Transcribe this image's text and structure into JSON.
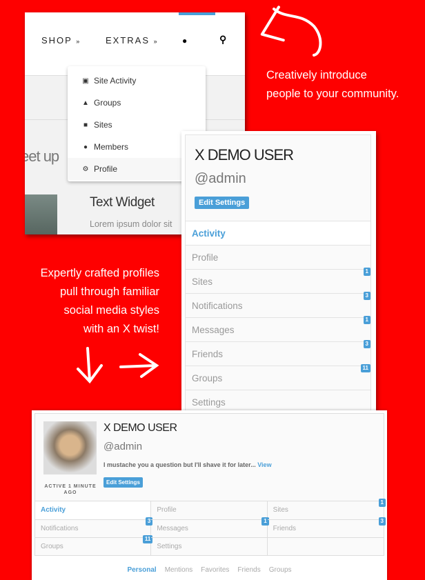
{
  "nav": {
    "shop": "SHOP",
    "extras": "EXTRAS",
    "chevron": "»"
  },
  "page": {
    "heading": "eet up",
    "widget_title": "Text Widget",
    "widget_text": "Lorem ipsum dolor sit"
  },
  "dropdown": [
    {
      "label": "Site Activity",
      "icon": "comments-icon"
    },
    {
      "label": "Groups",
      "icon": "sitemap-icon"
    },
    {
      "label": "Sites",
      "icon": "file-icon"
    },
    {
      "label": "Members",
      "icon": "male-icon"
    },
    {
      "label": "Profile",
      "icon": "gear-icon"
    }
  ],
  "captions": {
    "top": [
      "Creatively introduce",
      "people to your community."
    ],
    "left": [
      "Expertly crafted  profiles",
      "pull through familiar",
      "social media styles",
      "with an X twist!"
    ]
  },
  "profile": {
    "name": "X DEMO USER",
    "handle": "@admin",
    "edit": "Edit Settings",
    "status": "I mustache you a question but I'll shave it for later...",
    "view": "View",
    "last_active": "ACTIVE 1 MINUTE AGO",
    "menu": [
      {
        "label": "Activity",
        "badge": null
      },
      {
        "label": "Profile",
        "badge": null
      },
      {
        "label": "Sites",
        "badge": "1"
      },
      {
        "label": "Notifications",
        "badge": "3"
      },
      {
        "label": "Messages",
        "badge": "1"
      },
      {
        "label": "Friends",
        "badge": "3"
      },
      {
        "label": "Groups",
        "badge": "11"
      },
      {
        "label": "Settings",
        "badge": null
      }
    ],
    "tabs": [
      "Personal",
      "Mentions",
      "Favorites",
      "Friends",
      "Groups"
    ]
  },
  "colors": {
    "background": "#fe0000",
    "accent": "#4a9fd8"
  }
}
